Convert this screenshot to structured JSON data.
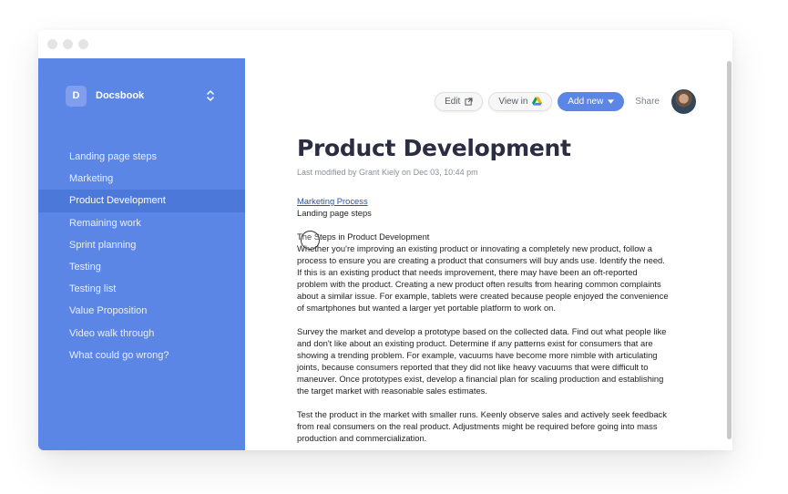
{
  "sidebar": {
    "brand_initial": "D",
    "brand_name": "Docsbook",
    "items": [
      {
        "label": "Landing page steps"
      },
      {
        "label": "Marketing"
      },
      {
        "label": "Product Development"
      },
      {
        "label": "Remaining work"
      },
      {
        "label": "Sprint planning"
      },
      {
        "label": "Testing"
      },
      {
        "label": "Testing list"
      },
      {
        "label": "Value Proposition"
      },
      {
        "label": "Video walk through"
      },
      {
        "label": "What could go wrong?"
      }
    ],
    "active_item": "Product Development"
  },
  "toolbar": {
    "edit_label": "Edit",
    "view_in_label": "View in",
    "add_new_label": "Add new",
    "share_label": "Share"
  },
  "document": {
    "title": "Product Development",
    "modified": "Last modified by Grant Kiely on Dec 03, 10:44 pm",
    "link_text": "Marketing Process",
    "line_after_link": "Landing page steps",
    "heading": "The Steps in Product Development",
    "paragraphs": [
      "Whether you're improving an existing product or innovating a completely new product, follow a process to ensure you are creating a product that consumers will buy ands use. Identify the need. If this is an existing product that needs improvement, there may have been an oft-reported problem with the product. Creating a new product often results from hearing common complaints about a similar issue. For example, tablets were created because people enjoyed the convenience of smartphones but wanted a larger yet portable platform to work on.",
      "Survey the market and develop a prototype based on the collected data. Find out what people like and don't like about an existing product. Determine if any patterns exist for consumers that are showing a trending problem. For example, vacuums have become more nimble with articulating joints, because consumers reported that they did not like heavy vacuums that were difficult to maneuver. Once prototypes exist, develop a financial plan for scaling production and establishing the target market with reasonable sales estimates.",
      "Test the product in the market with smaller runs. Keenly observe sales and actively seek feedback from real consumers on the real product. Adjustments might be required before going into mass production and commercialization."
    ]
  },
  "colors": {
    "sidebar_bg": "#5b86e5",
    "sidebar_active": "#4c78da",
    "accent": "#5b86e5",
    "title_text": "#2b2d42",
    "link": "#2752b3"
  },
  "icons": {
    "edit": "external-link-icon",
    "view_in": "google-drive-icon",
    "add_new": "caret-down-icon",
    "brand_switch": "chevron-up-down-icon"
  }
}
